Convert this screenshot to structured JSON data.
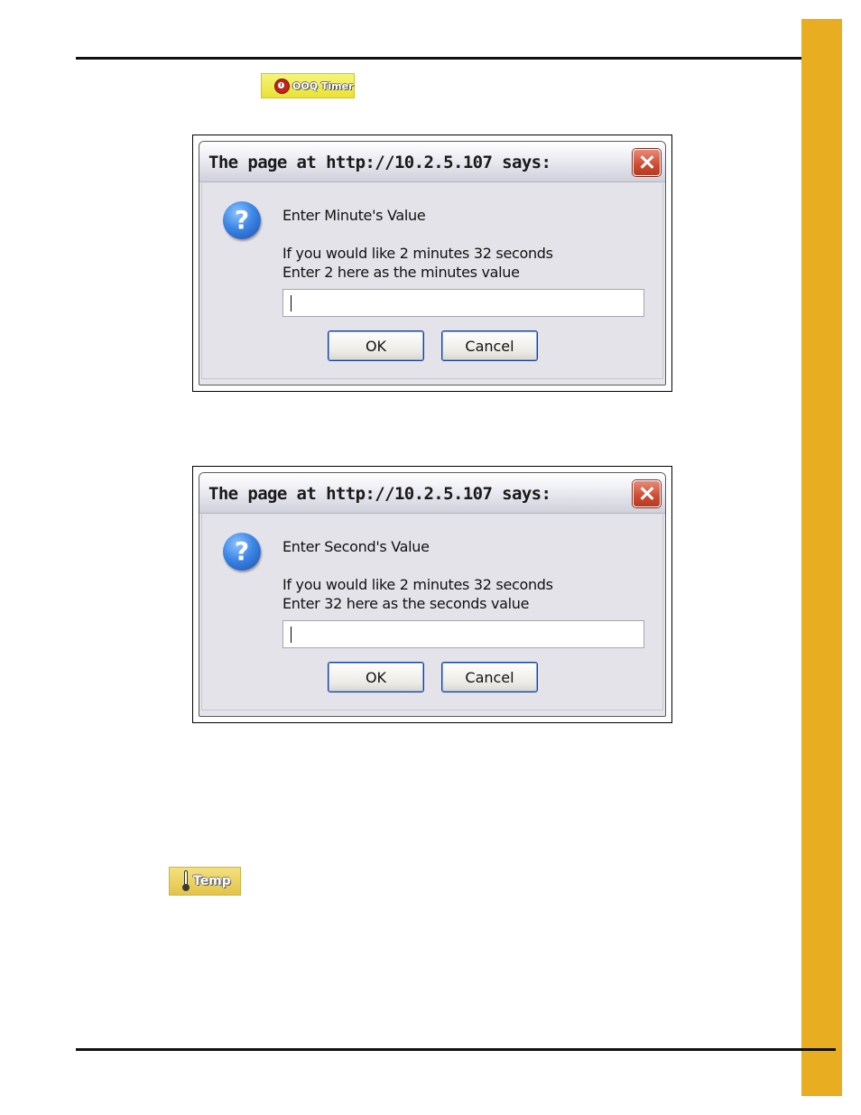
{
  "toolbar_buttons": {
    "ooq_timer": {
      "label": "OOQ Timer",
      "icon": "clock-icon"
    },
    "temp": {
      "label": "Temp",
      "icon": "thermometer-icon"
    }
  },
  "dialogs": [
    {
      "title": "The page at http://10.2.5.107 says:",
      "icon": "question-icon",
      "icon_glyph": "?",
      "heading": "Enter Minute's Value",
      "line1": "If you would like 2 minutes 32 seconds",
      "line2": "Enter 2 here as the minutes value",
      "input_value": "",
      "ok_label": "OK",
      "cancel_label": "Cancel"
    },
    {
      "title": "The page at http://10.2.5.107 says:",
      "icon": "question-icon",
      "icon_glyph": "?",
      "heading": "Enter Second's Value",
      "line1": "If you would like 2 minutes 32 seconds",
      "line2": "Enter 32 here as the seconds value",
      "input_value": "",
      "ok_label": "OK",
      "cancel_label": "Cancel"
    }
  ],
  "colors": {
    "side_tab": "#e8ad20",
    "rule": "#111111"
  }
}
